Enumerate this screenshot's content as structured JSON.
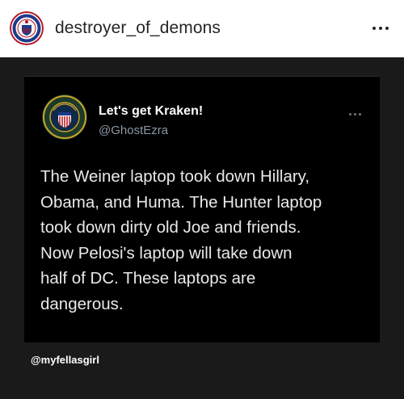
{
  "post": {
    "username": "destroyer_of_demons",
    "avatar_icon": "patriot-seal-avatar-icon",
    "more_icon": "more-options-icon"
  },
  "tweet": {
    "display_name": "Let's get Kraken!",
    "handle": "@GhostEzra",
    "avatar_icon": "defense-seal-avatar-icon",
    "more_icon": "more-options-icon",
    "text_lines": [
      "The Weiner laptop took down Hillary,",
      "Obama, and Huma. The Hunter laptop",
      "took down dirty old Joe and friends.",
      "Now Pelosi's laptop will take down",
      "half of DC. These laptops are",
      "dangerous."
    ]
  },
  "credit": "@myfellasgirl",
  "colors": {
    "post_background": "#1a1a1a",
    "card_background": "#000000",
    "handle_gray": "#8b98a5"
  }
}
